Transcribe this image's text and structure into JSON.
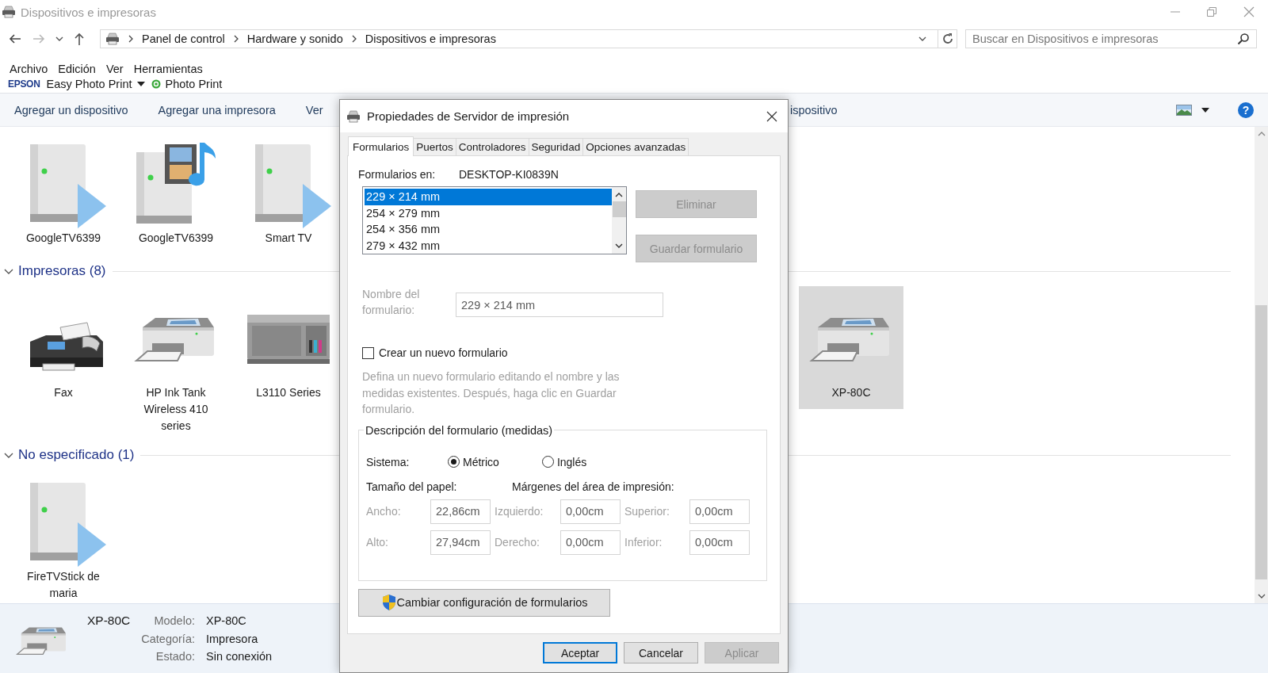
{
  "window": {
    "title": "Dispositivos e impresoras"
  },
  "address_bar": {
    "breadcrumbs": [
      "Panel de control",
      "Hardware y sonido",
      "Dispositivos e impresoras"
    ]
  },
  "search": {
    "placeholder": "Buscar en Dispositivos e impresoras"
  },
  "menu": [
    "Archivo",
    "Edición",
    "Ver",
    "Herramientas"
  ],
  "epson_bar": {
    "brand": "EPSON",
    "items": [
      {
        "label": "Easy Photo Print",
        "kind": "dropdown"
      },
      {
        "label": "Photo Print",
        "kind": "app"
      }
    ]
  },
  "command_bar": {
    "items": [
      "Agregar un dispositivo",
      "Agregar una impresora",
      "Ver",
      "ispositivo"
    ],
    "help": "?"
  },
  "groups": [
    {
      "items": [
        {
          "name": "GoogleTV6399",
          "kind": "media-server",
          "selected": false
        },
        {
          "name": "GoogleTV6399",
          "kind": "media-library",
          "selected": false
        },
        {
          "name": "Smart TV",
          "kind": "media-server",
          "selected": false
        }
      ]
    },
    {
      "title": "Impresoras (8)",
      "expanded": true,
      "items": [
        {
          "name": "Fax",
          "kind": "fax",
          "selected": false
        },
        {
          "name": "HP Ink Tank Wireless 410 series",
          "kind": "printer",
          "selected": false
        },
        {
          "name": "L3110 Series",
          "kind": "inkjet",
          "selected": false
        },
        {
          "name": "XP-80C",
          "kind": "printer",
          "selected": true
        }
      ]
    },
    {
      "title": "No especificado (1)",
      "expanded": true,
      "items": [
        {
          "name": "FireTVStick de maria",
          "kind": "media-server",
          "selected": false
        }
      ]
    }
  ],
  "details": {
    "name": "XP-80C",
    "kind": "printer",
    "fields": [
      {
        "label": "Modelo:",
        "value": "XP-80C"
      },
      {
        "label": "Categoría:",
        "value": "Impresora"
      },
      {
        "label": "Estado:",
        "value": "Sin conexión"
      }
    ]
  },
  "dialog": {
    "title": "Propiedades de Servidor de impresión",
    "tabs": [
      {
        "label": "Formularios",
        "selected": true
      },
      {
        "label": "Puertos",
        "selected": false
      },
      {
        "label": "Controladores",
        "selected": false
      },
      {
        "label": "Seguridad",
        "selected": false
      },
      {
        "label": "Opciones avanzadas",
        "selected": false
      }
    ],
    "forms_on": {
      "label": "Formularios en:",
      "value": "DESKTOP-KI0839N"
    },
    "forms_list": [
      {
        "label": "229 × 214 mm",
        "selected": true
      },
      {
        "label": "254 × 279 mm",
        "selected": false
      },
      {
        "label": "254 × 356 mm",
        "selected": false
      },
      {
        "label": "279 × 432 mm",
        "selected": false
      }
    ],
    "side_buttons": [
      {
        "label": "Eliminar",
        "disabled": true
      },
      {
        "label": "Guardar formulario",
        "disabled": true
      }
    ],
    "form_name": {
      "label": "Nombre del formulario:",
      "value": "229 × 214 mm",
      "disabled": true
    },
    "new_form": {
      "label": "Crear un nuevo formulario",
      "checked": false
    },
    "hint": "Defina un nuevo formulario editando el nombre y las medidas existentes. Después, haga clic en Guardar formulario.",
    "measures": {
      "title": "Descripción del formulario (medidas)",
      "system_label": "Sistema:",
      "systems": [
        {
          "label": "Métrico",
          "selected": true
        },
        {
          "label": "Inglés",
          "selected": false
        }
      ],
      "paper_label": "Tamaño del papel:",
      "margins_label": "Márgenes del área de impresión:",
      "fields": [
        {
          "label": "Ancho:",
          "value": "22,86cm",
          "disabled": true
        },
        {
          "label": "Izquierdo:",
          "value": "0,00cm",
          "disabled": true
        },
        {
          "label": "Superior:",
          "value": "0,00cm",
          "disabled": true
        },
        {
          "label": "Alto:",
          "value": "27,94cm",
          "disabled": true
        },
        {
          "label": "Derecho:",
          "value": "0,00cm",
          "disabled": true
        },
        {
          "label": "Inferior:",
          "value": "0,00cm",
          "disabled": true
        }
      ]
    },
    "change_button": "Cambiar configuración de formularios",
    "buttons": [
      {
        "label": "Aceptar",
        "default": true,
        "disabled": false
      },
      {
        "label": "Cancelar",
        "default": false,
        "disabled": false
      },
      {
        "label": "Aplicar",
        "default": false,
        "disabled": true
      }
    ]
  }
}
